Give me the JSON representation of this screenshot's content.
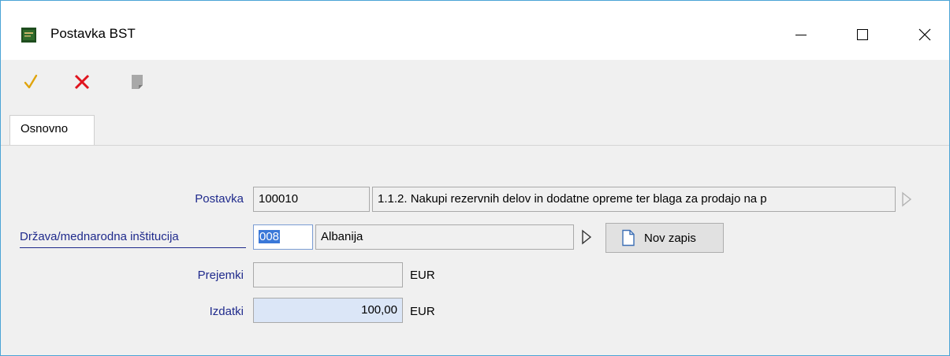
{
  "window": {
    "title": "Postavka BST",
    "minimize_glyph": "—",
    "maximize_glyph": "☐",
    "close_glyph": "✕"
  },
  "toolbar": {
    "confirm_icon": "checkmark-icon",
    "cancel_icon": "x-icon",
    "note_icon": "document-icon"
  },
  "tabs": [
    {
      "label": "Osnovno",
      "active": true
    }
  ],
  "form": {
    "postavka": {
      "label": "Postavka",
      "code": "100010",
      "description": "1.1.2. Nakupi rezervnih delov in dodatne opreme ter blaga za prodajo na p"
    },
    "drzava": {
      "label": "Država/mednarodna inštitucija",
      "code": "008",
      "name": "Albanija",
      "new_record_label": "Nov zapis"
    },
    "prejemki": {
      "label": "Prejemki",
      "value": "",
      "unit": "EUR"
    },
    "izdatki": {
      "label": "Izdatki",
      "value": "100,00",
      "unit": "EUR"
    }
  },
  "colors": {
    "accent_border": "#4aa3d6",
    "label_blue": "#1f2a8c",
    "selection": "#3a78d8",
    "highlight_field": "#dbe6f7",
    "cancel_red": "#e0141e",
    "check_gold": "#e0a40c"
  }
}
